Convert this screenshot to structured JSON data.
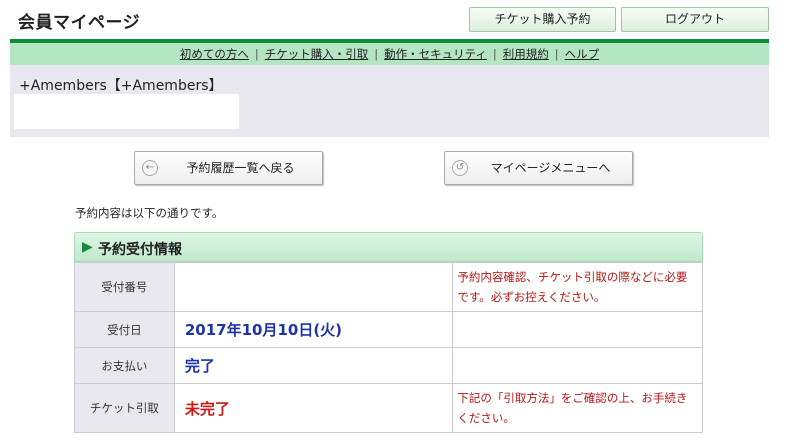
{
  "header": {
    "title": "会員マイページ",
    "buy_button": "チケット購入予約",
    "logout_button": "ログアウト"
  },
  "nav": {
    "items": [
      "初めての方へ",
      "チケット購入・引取",
      "動作・セキュリティ",
      "利用規約",
      "ヘルプ"
    ]
  },
  "member": {
    "name": "+Amembers【+Amembers】"
  },
  "buttons": {
    "back_label": "予約履歴一覧へ戻る",
    "menu_label": "マイページメニューへ"
  },
  "intro_text": "予約内容は以下の通りです。",
  "section": {
    "arrow": "▶",
    "title": "予約受付情報"
  },
  "rows": [
    {
      "label": "受付番号",
      "value": "",
      "note": "予約内容確認、チケット引取の際などに必要です。必ずお控えください。"
    },
    {
      "label": "受付日",
      "value": "2017年10月10日(火)",
      "note": ""
    },
    {
      "label": "お支払い",
      "value": "完了",
      "note": ""
    },
    {
      "label": "チケット引取",
      "value": "未完了",
      "note": "下記の「引取方法」をご確認の上、お手続きください。"
    }
  ],
  "colors": {
    "accent_green": "#138a3a",
    "nav_bg": "#b4e6c4",
    "value_blue": "#1f34a8",
    "value_red": "#d01818",
    "note_red": "#b81414"
  },
  "icons": {
    "back": "arrow-left-circle-icon",
    "menu": "refresh-circle-icon"
  }
}
